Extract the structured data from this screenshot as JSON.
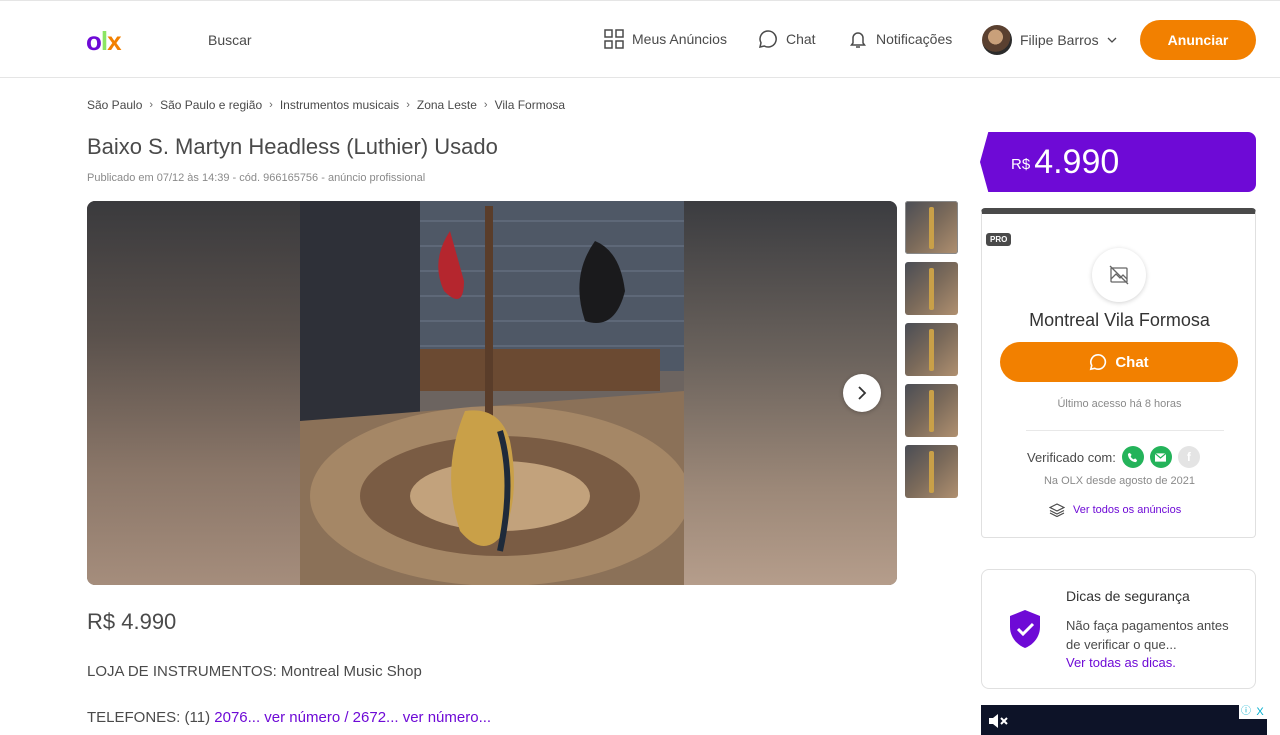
{
  "header": {
    "logo": {
      "o": "o",
      "l": "l",
      "x": "x"
    },
    "search_label": "Buscar",
    "nav": {
      "meus_anuncios": "Meus Anúncios",
      "chat": "Chat",
      "notificacoes": "Notificações",
      "user_name": "Filipe Barros"
    },
    "cta": "Anunciar"
  },
  "breadcrumb": [
    "São Paulo",
    "São Paulo e região",
    "Instrumentos musicais",
    "Zona Leste",
    "Vila Formosa"
  ],
  "listing": {
    "title": "Baixo S. Martyn Headless (Luthier) Usado",
    "meta": "Publicado em 07/12 às 14:39 - cód. 966165756 - anúncio profissional",
    "price": "R$ 4.990",
    "loja": "LOJA DE INSTRUMENTOS: Montreal Music Shop",
    "tel_prefix": "TELEFONES: (11) ",
    "tel_link": "2076... ver número / 2672... ver número..."
  },
  "price_box": {
    "currency": "R$",
    "value": "4.990"
  },
  "seller": {
    "badge": "PRO",
    "name": "Montreal Vila Formosa",
    "chat_label": "Chat",
    "last_access": "Último acesso há 8 horas",
    "verified_label": "Verificado com:",
    "facebook_glyph": "f",
    "since": "Na OLX desde agosto de 2021",
    "ver_todos": "Ver todos os anúncios"
  },
  "safety": {
    "title": "Dicas de segurança",
    "text": "Não faça pagamentos antes de verificar o que...",
    "link": "Ver todas as dicas."
  },
  "ad": {
    "info": "ⓘ",
    "close": "X"
  },
  "colors": {
    "purple": "#6e0ad6",
    "orange": "#f28000",
    "green": "#24b35a"
  }
}
